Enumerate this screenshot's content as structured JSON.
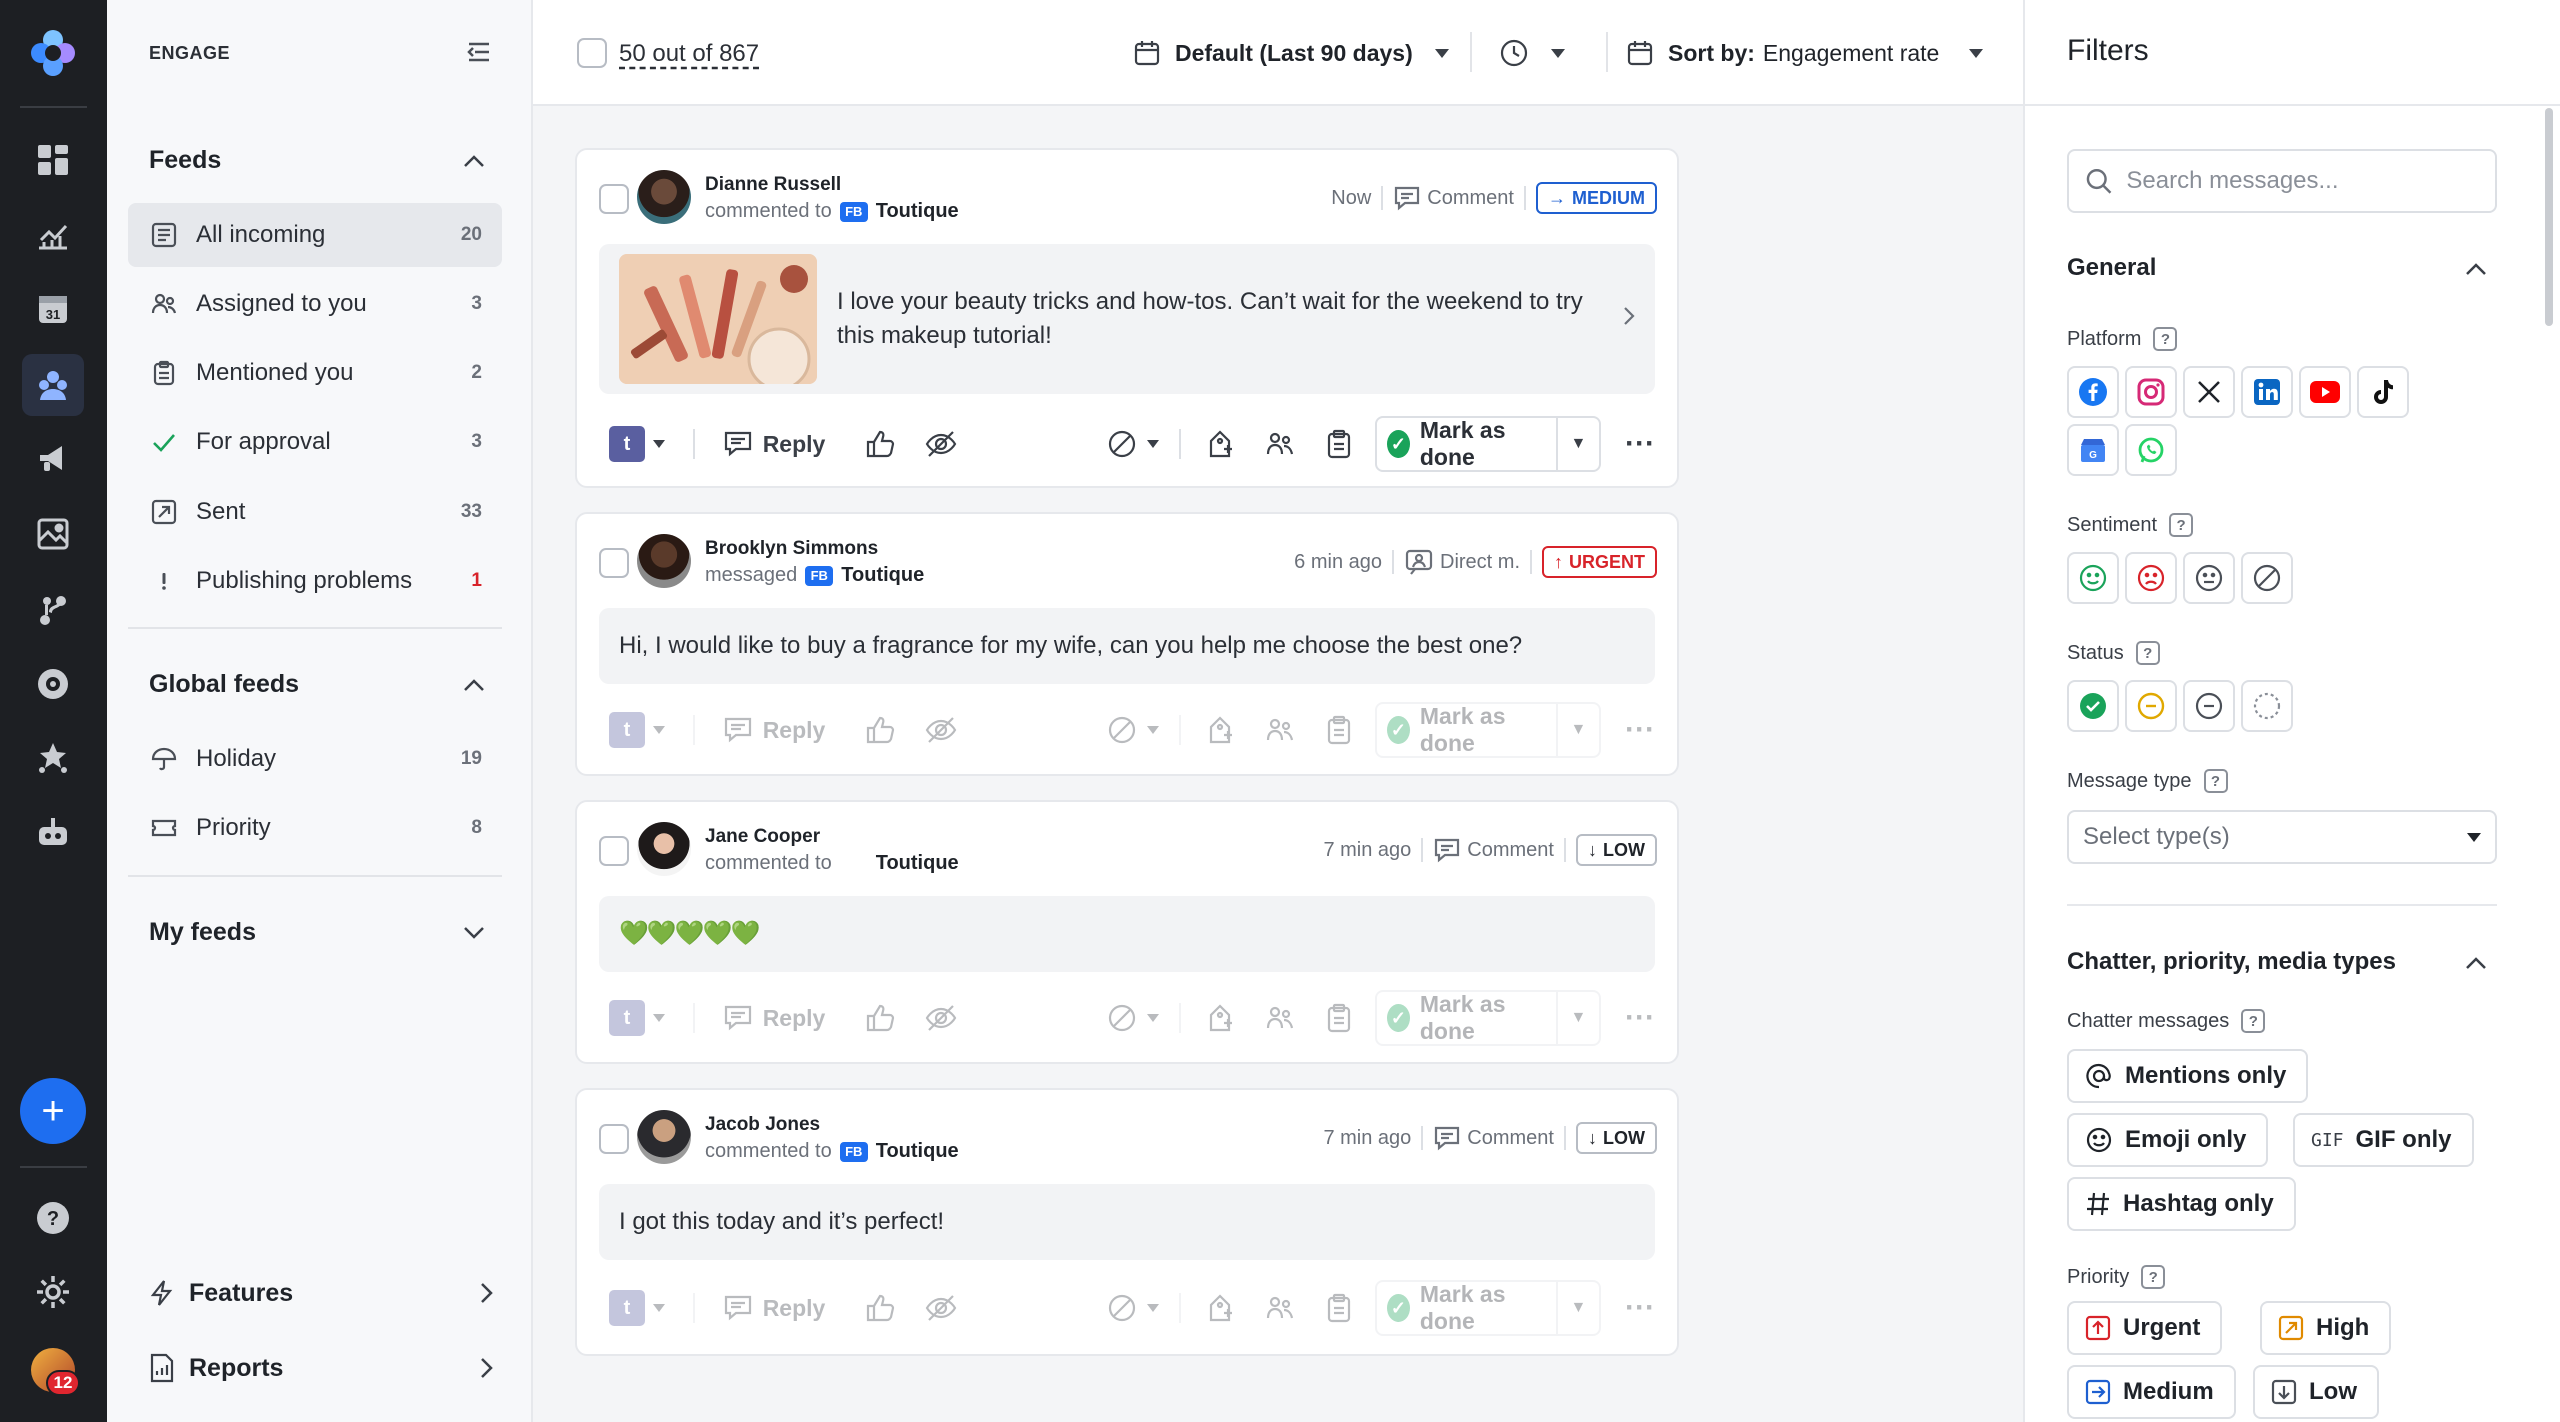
{
  "rail": {
    "notification_count": "12"
  },
  "sidebar": {
    "app_title": "ENGAGE",
    "feeds_title": "Feeds",
    "feeds": [
      {
        "label": "All incoming",
        "count": "20"
      },
      {
        "label": "Assigned to you",
        "count": "3"
      },
      {
        "label": "Mentioned you",
        "count": "2"
      },
      {
        "label": "For approval",
        "count": "3"
      },
      {
        "label": "Sent",
        "count": "33"
      },
      {
        "label": "Publishing problems",
        "count": "1"
      }
    ],
    "global_title": "Global feeds",
    "global": [
      {
        "label": "Holiday",
        "count": "19"
      },
      {
        "label": "Priority",
        "count": "8"
      }
    ],
    "my_feeds_title": "My feeds",
    "features_label": "Features",
    "reports_label": "Reports"
  },
  "topbar": {
    "count_text": "50 out of 867",
    "date_range": "Default (Last 90 days)",
    "sort_label": "Sort by:",
    "sort_value": "Engagement rate"
  },
  "actions": {
    "reply": "Reply",
    "mark_done": "Mark as done"
  },
  "messages": [
    {
      "name": "Dianne Russell",
      "verb": "commented to",
      "network": "FB",
      "page": "Toutique",
      "time": "Now",
      "type": "Comment",
      "priority": "MEDIUM",
      "text": "I love your beauty tricks and how-tos. Can’t wait for the weekend to try this makeup tutorial!"
    },
    {
      "name": "Brooklyn Simmons",
      "verb": "messaged",
      "network": "FB",
      "page": "Toutique",
      "time": "6 min ago",
      "type": "Direct m.",
      "priority": "URGENT",
      "text": "Hi, I would like to buy a fragrance for my wife, can you help me choose the best one?"
    },
    {
      "name": "Jane Cooper",
      "verb": "commented to",
      "network": "",
      "page": "Toutique",
      "time": "7 min ago",
      "type": "Comment",
      "priority": "LOW",
      "text": "💚💚💚💚💚"
    },
    {
      "name": "Jacob Jones",
      "verb": "commented to",
      "network": "FB",
      "page": "Toutique",
      "time": "7 min ago",
      "type": "Comment",
      "priority": "LOW",
      "text": "I got this today and it’s perfect!"
    }
  ],
  "filters": {
    "title": "Filters",
    "search_placeholder": "Search messages...",
    "general_title": "General",
    "platform_label": "Platform",
    "platform_icons": [
      "facebook-icon",
      "instagram-icon",
      "x-icon",
      "linkedin-icon",
      "youtube-icon",
      "tiktok-icon",
      "google-business-icon",
      "whatsapp-icon"
    ],
    "sentiment_label": "Sentiment",
    "status_label": "Status",
    "message_type_label": "Message type",
    "message_type_placeholder": "Select type(s)",
    "chatter_section_title": "Chatter, priority, media types",
    "chatter_label": "Chatter messages",
    "chatter_options": [
      "Mentions only",
      "Emoji only",
      "GIF only",
      "Hashtag only"
    ],
    "priority_label": "Priority",
    "priority_options": [
      "Urgent",
      "High",
      "Medium",
      "Low"
    ]
  },
  "colors": {
    "accent": "#1e6ef0",
    "rail_bg": "#1d1f23",
    "urgent": "#d8232a",
    "medium": "#1e5fd0",
    "done": "#1aa35a"
  }
}
